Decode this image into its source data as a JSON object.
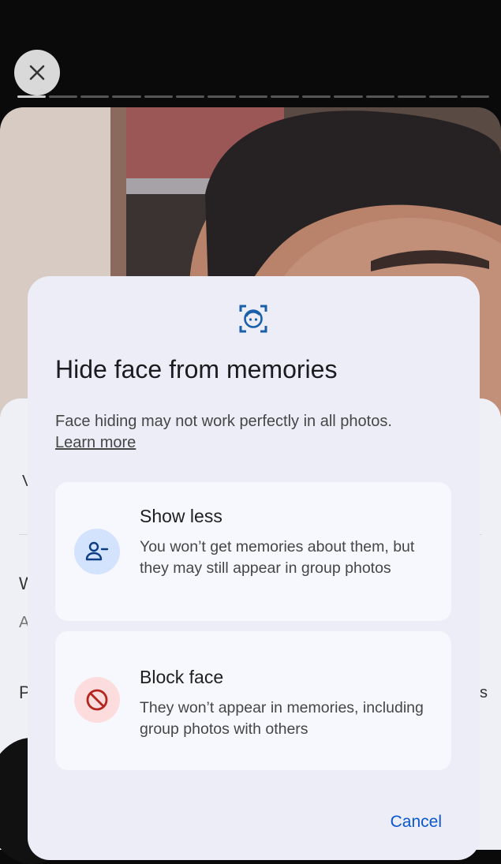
{
  "story": {
    "close_icon": "close-icon",
    "progress_segments": 15,
    "progress_active": 1
  },
  "behind": {
    "frag1": "V",
    "frag2": "W",
    "frag3": "A",
    "frag4": "P",
    "frag5": "s"
  },
  "dialog": {
    "icon": "face-scan-icon",
    "title": "Hide face from memories",
    "description": "Face hiding may not work perfectly in all photos.",
    "learn_more": "Learn more",
    "options": [
      {
        "icon": "person-minus-icon",
        "title": "Show less",
        "description": "You won’t get memories about them, but they may still appear in group photos"
      },
      {
        "icon": "block-icon",
        "title": "Block face",
        "description": "They won’t appear in memories, including group photos with others"
      }
    ],
    "cancel_label": "Cancel"
  },
  "colors": {
    "accent": "#0b57d0",
    "dialog_bg": "#ecedf7",
    "option_bg": "#f7f8fd",
    "show_less_icon_bg": "#d3e3fd",
    "block_icon_bg": "#fcdcdc",
    "block_icon": "#b3261e"
  }
}
